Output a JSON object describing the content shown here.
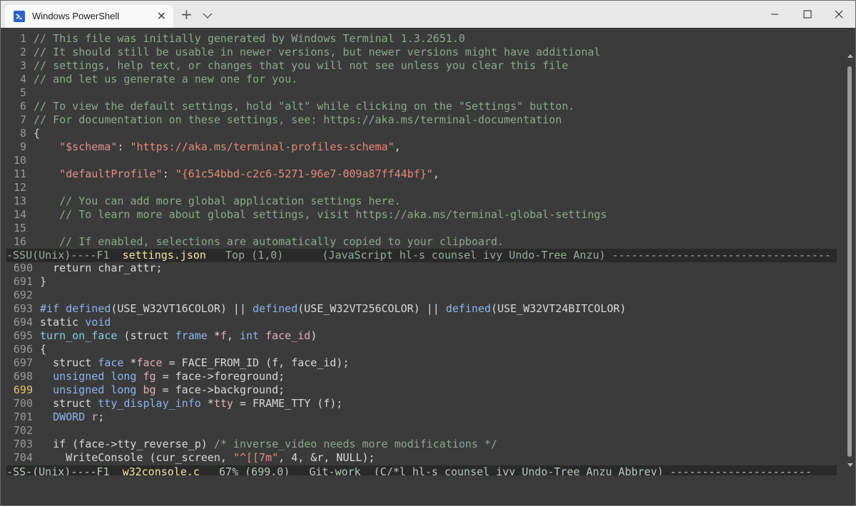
{
  "window": {
    "tab_title": "Windows PowerShell",
    "new_tab_symbol": "+",
    "close_symbol": "✕"
  },
  "top_pane": {
    "lines": [
      {
        "n": "1",
        "t": "// This file was initially generated by Windows Terminal 1.3.2651.0"
      },
      {
        "n": "2",
        "t": "// It should still be usable in newer versions, but newer versions might have additional"
      },
      {
        "n": "3",
        "t": "// settings, help text, or changes that you will not see unless you clear this file"
      },
      {
        "n": "4",
        "t": "// and let us generate a new one for you."
      },
      {
        "n": "5",
        "t": ""
      },
      {
        "n": "6",
        "t": "// To view the default settings, hold \"alt\" while clicking on the \"Settings\" button."
      },
      {
        "n": "7",
        "t": "// For documentation on these settings, see: https://aka.ms/terminal-documentation"
      },
      {
        "n": "8",
        "t": "{"
      },
      {
        "n": "9",
        "key": "\"$schema\"",
        "sep": ": ",
        "val": "\"https://aka.ms/terminal-profiles-schema\"",
        "end": ","
      },
      {
        "n": "10",
        "t": ""
      },
      {
        "n": "11",
        "key": "\"defaultProfile\"",
        "sep": ": ",
        "val": "\"{61c54bbd-c2c6-5271-96e7-009a87ff44bf}\"",
        "end": ","
      },
      {
        "n": "12",
        "t": ""
      },
      {
        "n": "13",
        "t": "    // You can add more global application settings here."
      },
      {
        "n": "14",
        "t": "    // To learn more about global settings, visit https://aka.ms/terminal-global-settings"
      },
      {
        "n": "15",
        "t": ""
      },
      {
        "n": "16",
        "t": "    // If enabled, selections are automatically copied to your clipboard."
      }
    ],
    "modeline": {
      "prefix": "-SSU(Unix)----F1  ",
      "buffer": "settings.json",
      "rest": "   Top (1,0)      (JavaScript hl-s counsel ivy Undo-Tree Anzu) ----------------------------------"
    }
  },
  "bottom_pane": {
    "n": [
      "690",
      "691",
      "692",
      "693",
      "694",
      "695",
      "696",
      "697",
      "698",
      "699",
      "700",
      "701",
      "702",
      "703",
      "704"
    ],
    "current_line": "699",
    "modeline": {
      "prefix": "-SS-(Unix)----F1  ",
      "buffer": "w32console.c",
      "rest": "   67% (699,0)   Git-work  (C/*l hl-s counsel ivy Undo-Tree Anzu Abbrev) ----------------------"
    }
  },
  "code": {
    "l690": {
      "return_kw": "return",
      "rest": " char_attr;"
    },
    "l691": "}",
    "l693": {
      "if": "#if",
      "def1": "defined",
      "a1": "(USE_W32VT16COLOR) || ",
      "def2": "defined",
      "a2": "(USE_W32VT256COLOR) || ",
      "def3": "defined",
      "a3": "(USE_W32VT24BITCOLOR)"
    },
    "l694": {
      "static": "static",
      "void": "void"
    },
    "l695": {
      "fn": "turn_on_face",
      "p1": " (",
      "struct": "struct",
      "ty": "frame",
      "p2": " *",
      "var": "f",
      "p3": ", ",
      "int": "int",
      "arg": "face_id",
      "p4": ")"
    },
    "l696": "{",
    "l697": {
      "struct": "struct",
      "ty": "face",
      "p1": " *",
      "var": "face",
      "rest": " = FACE_FROM_ID (f, face_id);"
    },
    "l698": {
      "unsigned": "unsigned",
      "long": "long",
      "var": "fg",
      "rest": " = face->foreground;"
    },
    "l699": {
      "unsigned": "unsigned",
      "long": "long",
      "var": "bg",
      "rest": " = face->background;"
    },
    "l700": {
      "struct": "struct",
      "ty": "tty_display_info",
      "p1": " *",
      "var": "tty",
      "rest": " = FRAME_TTY (f);"
    },
    "l701": {
      "ty": "DWORD",
      "var": "r",
      "rest": ";"
    },
    "l703": {
      "if": "if",
      "rest": " (face->tty_reverse_p) ",
      "cm": "/* inverse_video needs more modifications */"
    },
    "l704": {
      "fn": "WriteConsole",
      "p1": " (cur_screen, ",
      "str": "\"^[[7m\"",
      "rest": ", 4, &r, NULL);"
    }
  }
}
